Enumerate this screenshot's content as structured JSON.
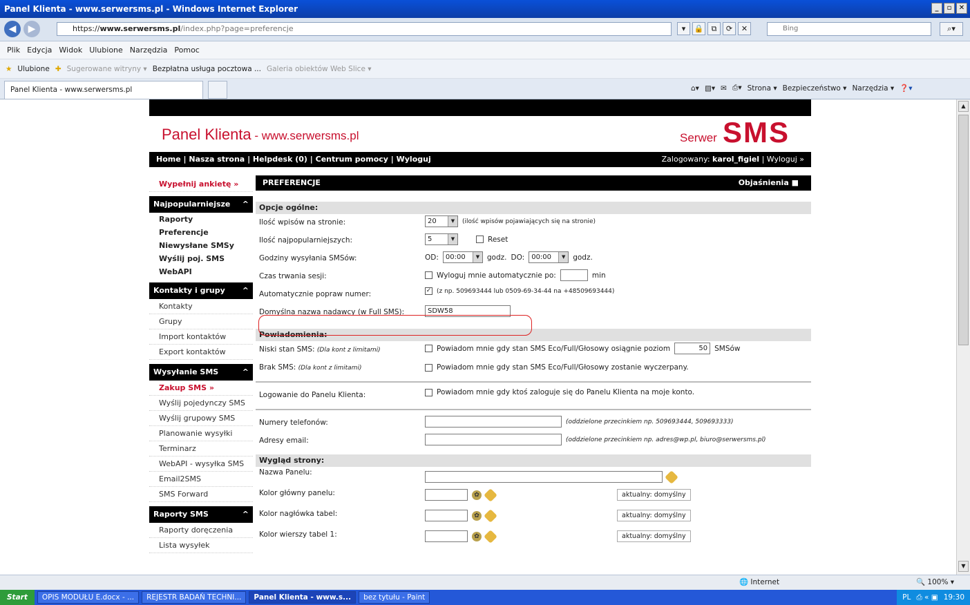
{
  "window": {
    "title": "Panel Klienta - www.serwersms.pl - Windows Internet Explorer"
  },
  "address": {
    "prefix": "https://",
    "domain": "www.serwersms.pl",
    "path": "/index.php?page=preferencje",
    "search_placeholder": "Bing"
  },
  "menu": [
    "Plik",
    "Edycja",
    "Widok",
    "Ulubione",
    "Narzędzia",
    "Pomoc"
  ],
  "favorites": {
    "label": "Ulubione",
    "items": [
      "Sugerowane witryny ▾",
      "Bezpłatna usługa pocztowa ...",
      "Galeria obiektów Web Slice ▾"
    ]
  },
  "tab": {
    "label": "Panel Klienta - www.serwersms.pl"
  },
  "cmdbar": {
    "strona": "Strona ▾",
    "bezp": "Bezpieczeństwo ▾",
    "narzedzia": "Narzędzia ▾"
  },
  "page": {
    "brand": "Panel Klienta",
    "brand_url": " - www.serwersms.pl",
    "logo_small": "Serwer",
    "logo_big": "SMS",
    "nav": "Home | Nasza strona | Helpdesk (0) | Centrum pomocy | Wyloguj",
    "user_prefix": "Zalogowany: ",
    "user_name": "karol_figiel",
    "user_suffix": " | Wyloguj »"
  },
  "sidebar": {
    "survey": "Wypełnij ankietę »",
    "sections": [
      {
        "title": "Najpopularniejsze",
        "items": [
          "Raporty",
          "Preferencje",
          "Niewysłane SMSy",
          "Wyślij poj. SMS",
          "WebAPI"
        ]
      },
      {
        "title": "Kontakty i grupy",
        "items": [
          "Kontakty",
          "Grupy",
          "Import kontaktów",
          "Export kontaktów"
        ]
      },
      {
        "title": "Wysyłanie SMS",
        "highlight": "Zakup SMS »",
        "items": [
          "Wyślij pojedynczy SMS",
          "Wyślij grupowy SMS",
          "Planowanie wysyłki",
          "Terminarz",
          "WebAPI - wysyłka SMS",
          "Email2SMS",
          "SMS Forward"
        ]
      },
      {
        "title": "Raporty SMS",
        "items": [
          "Raporty doręczenia",
          "Lista wysyłek"
        ]
      }
    ]
  },
  "main": {
    "title": "PREFERENCJE",
    "help": "Objaśnienia",
    "general": {
      "title": "Opcje ogólne:",
      "rows": {
        "per_page_label": "Ilość wpisów na stronie:",
        "per_page_value": "20",
        "per_page_hint": "(ilość wpisów pojawiających się na stronie)",
        "popular_label": "Ilość najpopularniejszych:",
        "popular_value": "5",
        "reset_label": "Reset",
        "hours_label": "Godziny wysyłania SMSów:",
        "od": "OD:",
        "od_value": "00:00",
        "godz": "godz.",
        "do": "DO:",
        "do_value": "00:00",
        "session_label": "Czas trwania sesji:",
        "session_text": "Wyloguj mnie automatycznie po:",
        "session_value": "",
        "session_unit": "min",
        "fix_label": "Automatycznie popraw numer:",
        "fix_hint": "(z np. 509693444 lub 0509-69-34-44 na +48509693444)",
        "sender_label": "Domyślna nazwa nadawcy (w Full SMS):",
        "sender_value": "SDW58"
      }
    },
    "notify": {
      "title": "Powiadomienia:",
      "low_label": "Niski stan SMS:",
      "low_note": "(Dla kont z limitami)",
      "low_text": "Powiadom mnie gdy stan SMS Eco/Full/Głosowy osiągnie poziom",
      "low_value": "50",
      "low_unit": "SMSów",
      "none_label": "Brak SMS:",
      "none_note": "(Dla kont z limitami)",
      "none_text": "Powiadom mnie gdy stan SMS Eco/Full/Głosowy zostanie wyczerpany.",
      "login_label": "Logowanie do Panelu Klienta:",
      "login_text": "Powiadom mnie gdy ktoś zaloguje się do Panelu Klienta na moje konto.",
      "phones_label": "Numery telefonów:",
      "phones_hint": "(oddzielone przecinkiem np. 509693444, 509693333)",
      "emails_label": "Adresy email:",
      "emails_hint": "(oddzielone przecinkiem np. adres@wp.pl, biuro@serwersms.pl)"
    },
    "look": {
      "title": "Wygląd strony:",
      "panel_name_label": "Nazwa Panelu:",
      "main_color_label": "Kolor główny panelu:",
      "header_color_label": "Kolor nagłówka tabel:",
      "rows_color_label": "Kolor wierszy tabel 1:",
      "current": "aktualny: domyślny"
    }
  },
  "statusbar": {
    "zone": "Internet",
    "zoom": "100%"
  },
  "taskbar": {
    "start": "Start",
    "tasks": [
      "OPIS MODUŁU E.docx - ...",
      "REJESTR BADAŃ TECHNI...",
      "Panel Klienta - www.s...",
      "bez tytułu - Paint"
    ],
    "lang": "PL",
    "time": "19:30"
  },
  "colors": {
    "brand_red": "#c8102e",
    "titlebar": "#0a50d8",
    "bar_black": "#000000",
    "highlight_oval": "#dd2222"
  }
}
